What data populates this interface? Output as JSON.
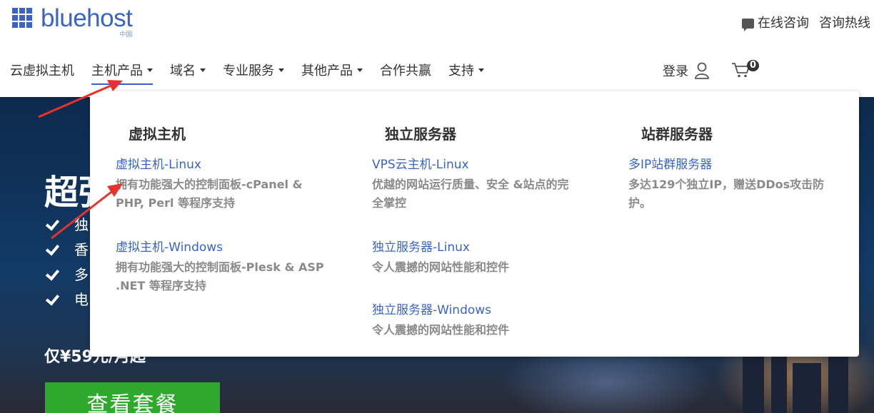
{
  "header": {
    "logo_text": "bluehost",
    "logo_sub": "中国",
    "online_consult": "在线咨询",
    "hotline": "咨询热线",
    "login": "登录",
    "cart_count": "0"
  },
  "nav": {
    "items": [
      {
        "label": "云虚拟主机",
        "caret": false
      },
      {
        "label": "主机产品",
        "caret": true
      },
      {
        "label": "域名",
        "caret": true
      },
      {
        "label": "专业服务",
        "caret": true
      },
      {
        "label": "其他产品",
        "caret": true
      },
      {
        "label": "合作共赢",
        "caret": false
      },
      {
        "label": "支持",
        "caret": true
      }
    ]
  },
  "hero": {
    "title": "超强",
    "checks": [
      "独",
      "香",
      "多",
      "电"
    ],
    "price": "仅¥59元/月起",
    "cta": "查看套餐"
  },
  "dropdown": {
    "columns": [
      {
        "title": "虚拟主机",
        "entries": [
          {
            "title": "虚拟主机-Linux",
            "desc": "拥有功能强大的控制面板-cPanel & PHP, Perl 等程序支持"
          },
          {
            "title": "虚拟主机-Windows",
            "desc": "拥有功能强大的控制面板-Plesk & ASP .NET 等程序支持"
          }
        ]
      },
      {
        "title": "独立服务器",
        "entries": [
          {
            "title": "VPS云主机-Linux",
            "desc": "优越的网站运行质量、安全 &站点的完全掌控"
          },
          {
            "title": "独立服务器-Linux",
            "desc": "令人震撼的网站性能和控件"
          },
          {
            "title": "独立服务器-Windows",
            "desc": "令人震撼的网站性能和控件"
          }
        ]
      },
      {
        "title": "站群服务器",
        "entries": [
          {
            "title": "多IP站群服务器",
            "desc": "多达129个独立IP，赠送DDos攻击防护。"
          }
        ]
      }
    ]
  },
  "colors": {
    "brand_blue": "#3a63c9",
    "cta_green": "#2fa82e",
    "annotation_red": "#e8322b"
  }
}
